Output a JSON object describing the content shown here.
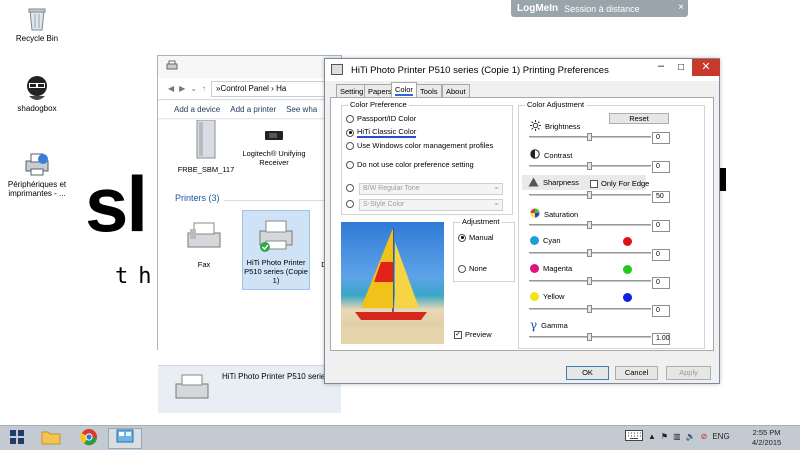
{
  "logmein": {
    "brand": "LogMeIn",
    "session": "Session à distance",
    "close": "×"
  },
  "desktop": {
    "icons": [
      {
        "label": "Recycle Bin"
      },
      {
        "label": "shadogbox"
      },
      {
        "label": "Périphériques et imprimantes - ..."
      }
    ],
    "wallpaper": {
      "logo": "sl",
      "tagline": "the"
    }
  },
  "explorer": {
    "breadcrumb": "Control Panel",
    "breadcrumb_next": "Ha",
    "commands": [
      "Add a device",
      "Add a printer",
      "See wha"
    ],
    "devices": [
      {
        "label": "FRBE_SBM_117"
      },
      {
        "label": "Logitech® Unifying Receiver"
      }
    ],
    "printers_heading": "Printers (3)",
    "printers": [
      {
        "label": "Fax"
      },
      {
        "label": "HiTi Photo Printer P510 series (Copie 1)"
      },
      {
        "label": "D"
      }
    ],
    "status_name": "HiTi Photo Printer P510 serie"
  },
  "dialog": {
    "title": "HiTi Photo Printer P510 series (Copie 1) Printing Preferences",
    "tabs": [
      "Setting",
      "Papers",
      "Color",
      "Tools",
      "About"
    ],
    "active_tab": "Color",
    "color_preference": {
      "label": "Color Preference",
      "options": [
        "Passport/ID Color",
        "HiTi Classic Color",
        "Use Windows color management profiles",
        "Do not use color preference setting"
      ],
      "selected": "HiTi Classic Color",
      "tone_select": "B/W Regular Tone",
      "style_select": "S-Style Color"
    },
    "adjustment": {
      "label": "Adjustment",
      "options": [
        "Manual",
        "None"
      ],
      "selected": "Manual"
    },
    "preview": {
      "label": "Preview",
      "checked": true
    },
    "color_adjustment": {
      "label": "Color Adjustment",
      "reset": "Reset",
      "only_for_edge": "Only For Edge",
      "sliders": [
        {
          "name": "Brightness",
          "value": "0"
        },
        {
          "name": "Contrast",
          "value": "0"
        },
        {
          "name": "Sharpness",
          "value": "50"
        },
        {
          "name": "Saturation",
          "value": "0"
        },
        {
          "name": "Cyan",
          "value": "0"
        },
        {
          "name": "Magenta",
          "value": "0"
        },
        {
          "name": "Yellow",
          "value": "0"
        },
        {
          "name": "Gamma",
          "value": "1.00"
        }
      ],
      "colors": {
        "cyan": "#1f9fd6",
        "red": "#e01010",
        "magenta": "#e0107e",
        "green": "#22c81a",
        "yellow": "#f3e312",
        "blue": "#1020e0"
      }
    },
    "buttons": {
      "ok": "OK",
      "cancel": "Cancel",
      "apply": "Apply"
    }
  },
  "taskbar": {
    "lang": "ENG",
    "time": "2:55 PM",
    "date": "4/2/2015"
  }
}
